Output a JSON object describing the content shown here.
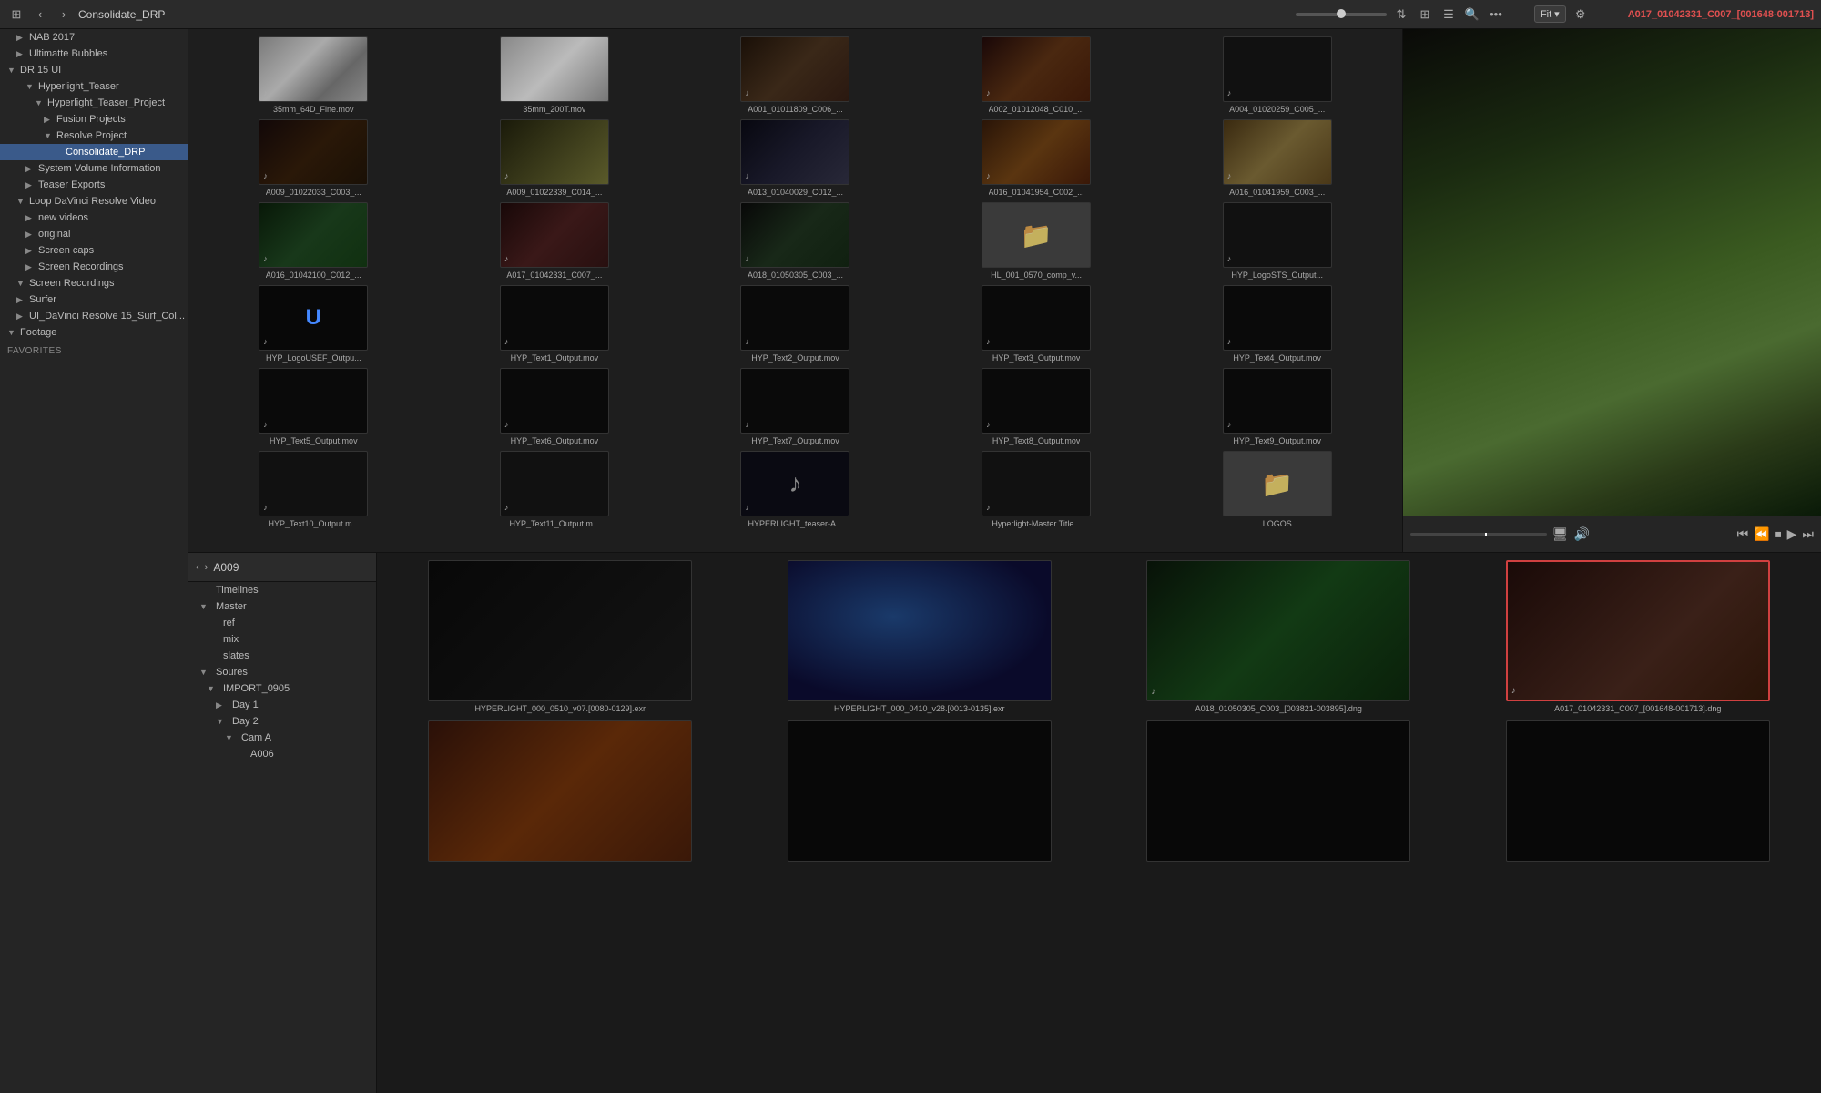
{
  "topbar": {
    "back_btn": "‹",
    "forward_btn": "›",
    "title": "Consolidate_DRP",
    "slider_value": 50,
    "view_grid_btn": "⊞",
    "view_list_btn": "☰",
    "search_btn": "🔍",
    "more_btn": "•••",
    "fit_label": "Fit",
    "fit_arrow": "▾",
    "active_clip": "A017_01042331_C007_[001648-001713]"
  },
  "sidebar": {
    "items": [
      {
        "id": "nab2017",
        "label": "NAB 2017",
        "indent": 1,
        "chevron": "closed"
      },
      {
        "id": "ultimatte-bubbles",
        "label": "Ultimatte Bubbles",
        "indent": 1,
        "chevron": "closed"
      },
      {
        "id": "dr15ui",
        "label": "DR 15 UI",
        "indent": 0,
        "chevron": "open"
      },
      {
        "id": "hyperlight-teaser",
        "label": "Hyperlight_Teaser",
        "indent": 2,
        "chevron": "open"
      },
      {
        "id": "hyperlight-teaser-project",
        "label": "Hyperlight_Teaser_Project",
        "indent": 3,
        "chevron": "open"
      },
      {
        "id": "fusion-projects",
        "label": "Fusion Projects",
        "indent": 4,
        "chevron": "closed"
      },
      {
        "id": "resolve-project",
        "label": "Resolve Project",
        "indent": 4,
        "chevron": "open"
      },
      {
        "id": "consolidate-drp",
        "label": "Consolidate_DRP",
        "indent": 5,
        "chevron": "empty",
        "selected": true
      },
      {
        "id": "system-volume",
        "label": "System Volume Information",
        "indent": 2,
        "chevron": "closed"
      },
      {
        "id": "teaser-exports",
        "label": "Teaser Exports",
        "indent": 2,
        "chevron": "closed"
      },
      {
        "id": "loop-davinci",
        "label": "Loop DaVinci Resolve Video",
        "indent": 1,
        "chevron": "open"
      },
      {
        "id": "new-videos",
        "label": "new videos",
        "indent": 2,
        "chevron": "closed"
      },
      {
        "id": "original",
        "label": "original",
        "indent": 2,
        "chevron": "closed"
      },
      {
        "id": "screen-caps",
        "label": "Screen caps",
        "indent": 2,
        "chevron": "closed"
      },
      {
        "id": "screen-recordings-1",
        "label": "Screen Recordings",
        "indent": 2,
        "chevron": "closed"
      },
      {
        "id": "screen-recordings-2",
        "label": "Screen Recordings",
        "indent": 1,
        "chevron": "open"
      },
      {
        "id": "surfer",
        "label": "Surfer",
        "indent": 1,
        "chevron": "closed"
      },
      {
        "id": "ui-davinci",
        "label": "UI_DaVinci Resolve 15_Surf_Col...",
        "indent": 1,
        "chevron": "closed"
      },
      {
        "id": "footage",
        "label": "Footage",
        "indent": 0,
        "chevron": "open"
      }
    ],
    "favorites_label": "Favorites"
  },
  "media_items": [
    {
      "id": "item1",
      "label": "35mm_64D_Fine.mov",
      "thumb_type": "grain",
      "has_audio": true
    },
    {
      "id": "item2",
      "label": "35mm_200T.mov",
      "thumb_type": "grain2",
      "has_audio": false
    },
    {
      "id": "item3",
      "label": "A001_01011809_C006_...",
      "thumb_type": "person1",
      "has_audio": true
    },
    {
      "id": "item4",
      "label": "A002_01012048_C010_...",
      "thumb_type": "person2",
      "has_audio": true
    },
    {
      "id": "item5",
      "label": "A004_01020259_C005_...",
      "thumb_type": "dark",
      "has_audio": true
    },
    {
      "id": "item6",
      "label": "A009_01022033_C003_...",
      "thumb_type": "person3",
      "has_audio": true
    },
    {
      "id": "item7",
      "label": "A009_01022339_C014_...",
      "thumb_type": "logo_00",
      "has_audio": true
    },
    {
      "id": "item8",
      "label": "A013_01040029_C012_...",
      "thumb_type": "person4",
      "has_audio": true
    },
    {
      "id": "item9",
      "label": "A016_01041954_C002_...",
      "thumb_type": "orange",
      "has_audio": true
    },
    {
      "id": "item10",
      "label": "A016_01041959_C003_...",
      "thumb_type": "bright",
      "has_audio": true
    },
    {
      "id": "item11",
      "label": "A016_01042100_C012_...",
      "thumb_type": "green",
      "has_audio": true
    },
    {
      "id": "item12",
      "label": "A017_01042331_C007_...",
      "thumb_type": "person5",
      "has_audio": true
    },
    {
      "id": "item13",
      "label": "A018_01050305_C003_...",
      "thumb_type": "person6",
      "has_audio": true
    },
    {
      "id": "item14",
      "label": "HL_001_0570_comp_v...",
      "thumb_type": "folder",
      "has_audio": false
    },
    {
      "id": "item15",
      "label": "HYP_LogoSTS_Output...",
      "thumb_type": "dark",
      "has_audio": true
    },
    {
      "id": "item16",
      "label": "HYP_LogoUSEF_Outpu...",
      "thumb_type": "logo_u",
      "has_audio": true
    },
    {
      "id": "item17",
      "label": "HYP_Text1_Output.mov",
      "thumb_type": "text",
      "has_audio": true
    },
    {
      "id": "item18",
      "label": "HYP_Text2_Output.mov",
      "thumb_type": "text",
      "has_audio": true
    },
    {
      "id": "item19",
      "label": "HYP_Text3_Output.mov",
      "thumb_type": "text",
      "has_audio": true
    },
    {
      "id": "item20",
      "label": "HYP_Text4_Output.mov",
      "thumb_type": "text",
      "has_audio": true
    },
    {
      "id": "item21",
      "label": "HYP_Text5_Output.mov",
      "thumb_type": "text",
      "has_audio": true
    },
    {
      "id": "item22",
      "label": "HYP_Text6_Output.mov",
      "thumb_type": "text",
      "has_audio": true
    },
    {
      "id": "item23",
      "label": "HYP_Text7_Output.mov",
      "thumb_type": "text",
      "has_audio": true
    },
    {
      "id": "item24",
      "label": "HYP_Text8_Output.mov",
      "thumb_type": "text",
      "has_audio": true
    },
    {
      "id": "item25",
      "label": "HYP_Text9_Output.mov",
      "thumb_type": "text",
      "has_audio": true
    },
    {
      "id": "item26",
      "label": "HYP_Text10_Output.m...",
      "thumb_type": "dark",
      "has_audio": true
    },
    {
      "id": "item27",
      "label": "HYP_Text11_Output.m...",
      "thumb_type": "dark",
      "has_audio": true
    },
    {
      "id": "item28",
      "label": "HYPERLIGHT_teaser-A...",
      "thumb_type": "music",
      "has_audio": true
    },
    {
      "id": "item29",
      "label": "Hyperlight-Master Title...",
      "thumb_type": "dark",
      "has_audio": true
    },
    {
      "id": "item30",
      "label": "LOGOS",
      "thumb_type": "folder",
      "has_audio": false
    }
  ],
  "timeline": {
    "header_title": "A009",
    "items": [
      {
        "id": "timelines",
        "label": "Timelines",
        "indent": 0,
        "chevron": "empty"
      },
      {
        "id": "master",
        "label": "Master",
        "indent": 0,
        "chevron": "open"
      },
      {
        "id": "ref",
        "label": "ref",
        "indent": 1,
        "chevron": "empty"
      },
      {
        "id": "mix",
        "label": "mix",
        "indent": 1,
        "chevron": "empty"
      },
      {
        "id": "slates",
        "label": "slates",
        "indent": 1,
        "chevron": "empty"
      },
      {
        "id": "soures",
        "label": "Soures",
        "indent": 0,
        "chevron": "open"
      },
      {
        "id": "import0905",
        "label": "IMPORT_0905",
        "indent": 1,
        "chevron": "open"
      },
      {
        "id": "day1",
        "label": "Day 1",
        "indent": 2,
        "chevron": "closed"
      },
      {
        "id": "day2",
        "label": "Day 2",
        "indent": 2,
        "chevron": "open"
      },
      {
        "id": "cama",
        "label": "Cam A",
        "indent": 3,
        "chevron": "open"
      },
      {
        "id": "a006",
        "label": "A006",
        "indent": 4,
        "chevron": "empty"
      }
    ]
  },
  "clips": [
    {
      "id": "clip1",
      "label": "HYPERLIGHT_000_0510_v07.[0080-0129].exr",
      "bg": "dark",
      "has_audio": false,
      "selected": false
    },
    {
      "id": "clip2",
      "label": "HYPERLIGHT_000_0410_v28.[0013-0135].exr",
      "bg": "space",
      "has_audio": false,
      "selected": false
    },
    {
      "id": "clip3",
      "label": "A018_01050305_C003_[003821-003895].dng",
      "bg": "green_person",
      "has_audio": true,
      "selected": false
    },
    {
      "id": "clip4",
      "label": "A017_01042331_C007_[001648-001713].dng",
      "bg": "person",
      "has_audio": true,
      "selected": true
    },
    {
      "id": "clip5",
      "label": "",
      "bg": "fire",
      "has_audio": false,
      "selected": false
    },
    {
      "id": "clip6",
      "label": "",
      "bg": "dark2",
      "has_audio": false,
      "selected": false
    },
    {
      "id": "clip7",
      "label": "",
      "bg": "dark2",
      "has_audio": false,
      "selected": false
    },
    {
      "id": "clip8",
      "label": "",
      "bg": "dark2",
      "has_audio": false,
      "selected": false
    }
  ]
}
